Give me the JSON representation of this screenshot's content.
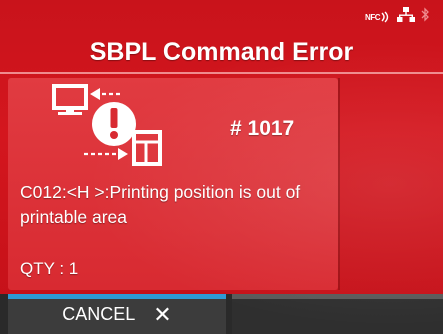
{
  "header": {
    "title": "SBPL Command Error",
    "status_icons": {
      "nfc_label": "NFC",
      "network": "network-icon",
      "bluetooth": "bluetooth-icon"
    }
  },
  "error": {
    "icon": "printer-error-icon",
    "code": "# 1017",
    "message": "C012:<H >:Printing position is out of printable area",
    "qty": "QTY : 1"
  },
  "footer": {
    "cancel_label": "CANCEL",
    "cancel_icon": "close-icon"
  },
  "colors": {
    "background": "#c9131b",
    "panel": "#e13b41",
    "active_softkey_bar": "#2e9ad4",
    "footer": "#2a2a2a"
  }
}
